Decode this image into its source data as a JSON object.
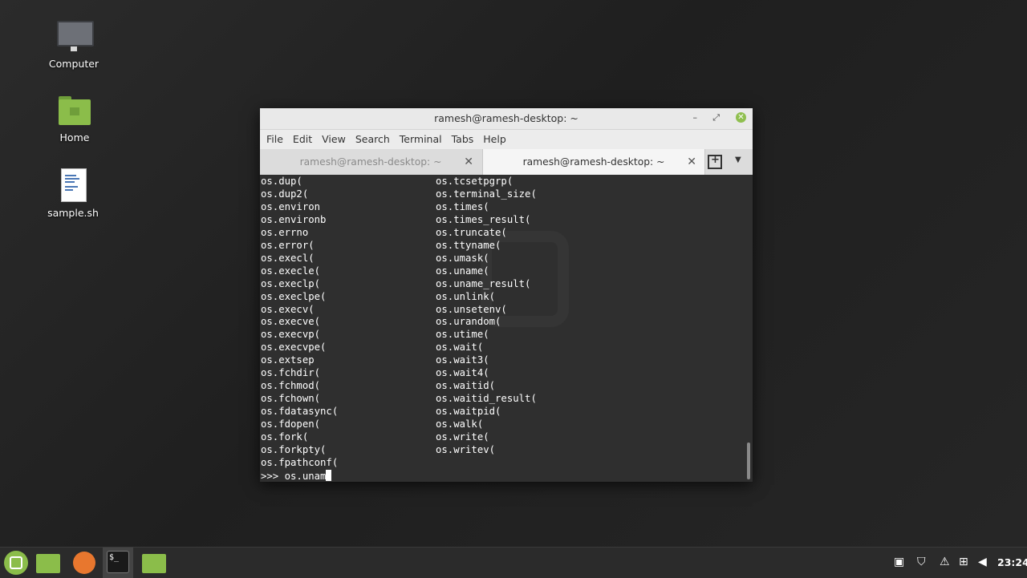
{
  "desktop": {
    "icons": [
      {
        "label": "Computer"
      },
      {
        "label": "Home"
      },
      {
        "label": "sample.sh"
      }
    ]
  },
  "window": {
    "title": "ramesh@ramesh-desktop: ~",
    "minimize_glyph": "–",
    "maximize_glyph": "⤢",
    "close_glyph": "✕"
  },
  "menubar": [
    "File",
    "Edit",
    "View",
    "Search",
    "Terminal",
    "Tabs",
    "Help"
  ],
  "tabs": [
    {
      "label": "ramesh@ramesh-desktop: ~",
      "active": false
    },
    {
      "label": "ramesh@ramesh-desktop: ~",
      "active": true
    }
  ],
  "tab_close_glyph": "✕",
  "terminal": {
    "column1": [
      "os.dup(",
      "os.dup2(",
      "os.environ",
      "os.environb",
      "os.errno",
      "os.error(",
      "os.execl(",
      "os.execle(",
      "os.execlp(",
      "os.execlpe(",
      "os.execv(",
      "os.execve(",
      "os.execvp(",
      "os.execvpe(",
      "os.extsep",
      "os.fchdir(",
      "os.fchmod(",
      "os.fchown(",
      "os.fdatasync(",
      "os.fdopen(",
      "os.fork(",
      "os.forkpty(",
      "os.fpathconf("
    ],
    "column2": [
      "os.tcsetpgrp(",
      "os.terminal_size(",
      "os.times(",
      "os.times_result(",
      "os.truncate(",
      "os.ttyname(",
      "os.umask(",
      "os.uname(",
      "os.uname_result(",
      "os.unlink(",
      "os.unsetenv(",
      "os.urandom(",
      "os.utime(",
      "os.wait(",
      "os.wait3(",
      "os.wait4(",
      "os.waitid(",
      "os.waitid_result(",
      "os.waitpid(",
      "os.walk(",
      "os.write(",
      "os.writev("
    ],
    "prompt": ">>> ",
    "input": "os.unam"
  },
  "panel": {
    "clock": "23:24",
    "terminal_icon_text": "$_"
  },
  "colors": {
    "terminal_bg": "#2f2f2f",
    "mint_green": "#8bbd4a",
    "panel_bg": "#2b2b2b"
  }
}
